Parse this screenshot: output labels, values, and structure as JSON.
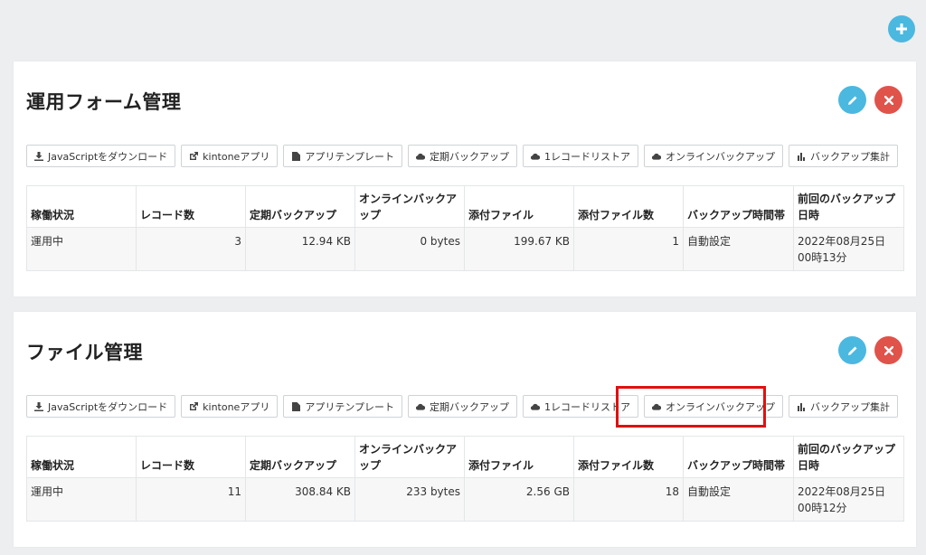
{
  "columns": [
    "稼働状況",
    "レコード数",
    "定期バックアップ",
    "オンラインバックアップ",
    "添付ファイル",
    "添付ファイル数",
    "バックアップ時間帯",
    "前回のバックアップ日時"
  ],
  "buttons": [
    "JavaScriptをダウンロード",
    "kintoneアプリ",
    "アプリテンプレート",
    "定期バックアップ",
    "1レコードリストア",
    "オンラインバックアップ",
    "バックアップ集計"
  ],
  "panels": [
    {
      "title": "運用フォーム管理",
      "row": [
        "運用中",
        "3",
        "12.94 KB",
        "0 bytes",
        "199.67 KB",
        "1",
        "自動設定",
        "2022年08月25日 00時13分"
      ]
    },
    {
      "title": "ファイル管理",
      "row": [
        "運用中",
        "11",
        "308.84 KB",
        "233 bytes",
        "2.56 GB",
        "18",
        "自動設定",
        "2022年08月25日 00時12分"
      ]
    }
  ],
  "colors": {
    "accent": "#4bb8e0",
    "danger": "#e0534a",
    "highlight": "#e01010"
  },
  "icons": {
    "add": "plus-icon",
    "edit": "pencil-icon",
    "delete": "close-icon",
    "buttons": [
      "download-icon",
      "external-link-icon",
      "file-icon",
      "cloud-icon",
      "cloud-icon",
      "cloud-icon",
      "bar-chart-icon"
    ]
  }
}
